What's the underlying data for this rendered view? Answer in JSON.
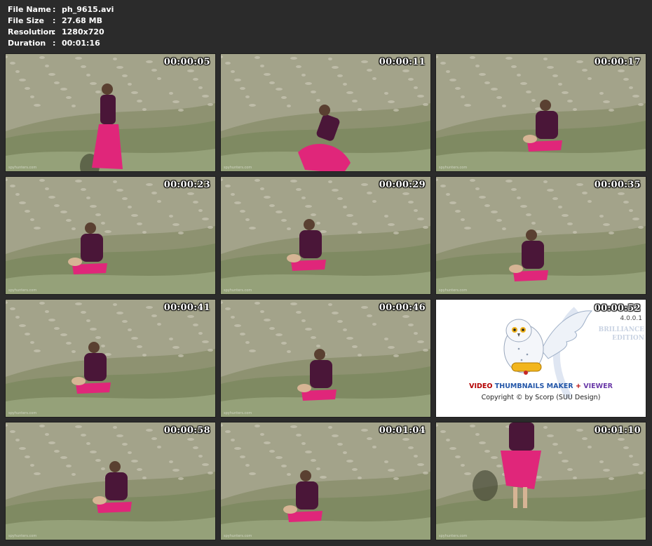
{
  "file_info": [
    {
      "label": "File Name",
      "value": "ph_9615.avi"
    },
    {
      "label": "File Size",
      "value": "27.68 MB"
    },
    {
      "label": "Resolution",
      "value": "1280x720"
    },
    {
      "label": "Duration",
      "value": "00:01:16"
    }
  ],
  "thumbnails": [
    {
      "timestamp": "00:00:05",
      "watermark": "spyhunters.com"
    },
    {
      "timestamp": "00:00:11",
      "watermark": "spyhunters.com"
    },
    {
      "timestamp": "00:00:17",
      "watermark": "spyhunters.com"
    },
    {
      "timestamp": "00:00:23",
      "watermark": "spyhunters.com"
    },
    {
      "timestamp": "00:00:29",
      "watermark": "spyhunters.com"
    },
    {
      "timestamp": "00:00:35",
      "watermark": "spyhunters.com"
    },
    {
      "timestamp": "00:00:41",
      "watermark": "spyhunters.com"
    },
    {
      "timestamp": "00:00:46",
      "watermark": "spyhunters.com"
    },
    {
      "timestamp": "00:00:52",
      "is_logo": true
    },
    {
      "timestamp": "00:00:58",
      "watermark": "spyhunters.com"
    },
    {
      "timestamp": "00:01:04",
      "watermark": "spyhunters.com"
    },
    {
      "timestamp": "00:01:10",
      "watermark": "spyhunters.com"
    }
  ],
  "logo": {
    "version": "4.0.0.1",
    "edition_line1": "BRILLIANCE",
    "edition_line2": "EDITION",
    "title_video": "VIDEO",
    "title_thumbnails": "THUMBNAILS MAKER",
    "title_plus": "+",
    "title_viewer": "VIEWER",
    "copyright": "Copyright © by Scorp (SUU Design)"
  },
  "colors": {
    "background": "#2b2b2b",
    "grass": "#8a8f6d",
    "skirt": "#e0267a",
    "jacket": "#4a1638"
  }
}
